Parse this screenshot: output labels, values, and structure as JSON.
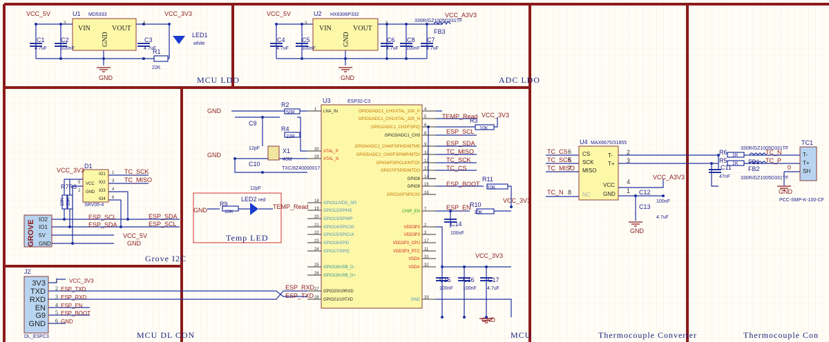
{
  "sections": {
    "mcu_ldo": "MCU LDO",
    "adc_ldo": "ADC LDO",
    "grove_i2c": "Grove I2C",
    "mcu_dl_con": "MCU DL CON",
    "mcu": "MCU",
    "tc_converter": "Thermocouple Converter",
    "tc_connector": "Thermocouple Con"
  },
  "mcu_ldo": {
    "vcc_in": "VCC_5V",
    "vcc_out": "VCC_3V3",
    "u1": "U1",
    "u1_part": "MD5333",
    "vin": "VIN",
    "vout": "VOUT",
    "gnd_pin": "GND",
    "pin3": "3",
    "pin2": "2",
    "c1": "C1",
    "c1_val": "4.7uF",
    "c2": "C2",
    "c2_val": "100nF",
    "c3": "C3",
    "c3_val": "4.7uF",
    "r1": "R1",
    "r1_val": "22K",
    "led1": "LED1",
    "led1_val": "white",
    "gnd": "GND"
  },
  "adc_ldo": {
    "vcc_in": "VCC_5V",
    "vcc_out": "VCC_A3V3",
    "u2": "U2",
    "u2_part": "HX6306P332",
    "vin": "VIN",
    "vout": "VOUT",
    "gnd_pin": "GND",
    "pin3": "3",
    "pin2": "2",
    "c4": "C4",
    "c4_val": "4.7uF",
    "c5": "C5",
    "c5_val": "100nF",
    "c6": "C6",
    "c6_val": "4.7uF",
    "c8": "C8",
    "c8_val": "100nF",
    "c7": "C7",
    "c7_val": "4.7uF",
    "fb3": "FB3",
    "fb3_val": "330R/GZ1005D331TF",
    "gnd": "GND"
  },
  "mcu": {
    "u3": "U3",
    "u3_part": "ESP32-C3",
    "left_pins": [
      {
        "name": "LNA_IN",
        "num": "1"
      },
      {
        "name": "XTAL_P",
        "num": "30"
      },
      {
        "name": "XTAL_N",
        "num": "29"
      },
      {
        "name": "GPIO11/VDD_SPI",
        "num": "18"
      },
      {
        "name": "GPIO12/SPIHD",
        "num": "19"
      },
      {
        "name": "GPIO13/SPIWP",
        "num": "20"
      },
      {
        "name": "GPIO14/SPICS0",
        "num": "21"
      },
      {
        "name": "GPIO15/SPICLK",
        "num": "22"
      },
      {
        "name": "GPIO16/SPID",
        "num": "23"
      },
      {
        "name": "GPIO17/SPIQ",
        "num": "24"
      },
      {
        "name": "GPIO18/USB_D-",
        "num": "25"
      },
      {
        "name": "GPIO19/USB_D+",
        "num": "26"
      },
      {
        "name": "GPIO20/U0RXD",
        "num": "27"
      },
      {
        "name": "GPIO21/U0TXD",
        "num": "28"
      }
    ],
    "right_pins": [
      {
        "name": "GPIO0/ADC1_CH0/XTAL_32K_P",
        "num": "4"
      },
      {
        "name": "GPIO1/ADC1_CH1/XTAL_32K_N",
        "num": "5"
      },
      {
        "name": "GPIO2/ADC1_CH2/FSPIQ",
        "num": "6"
      },
      {
        "name": "GPIO3/ADC1_CH3",
        "num": "8"
      },
      {
        "name": "GPIO4/ADC1_CH4/FSPIHD/MTMS",
        "num": "9"
      },
      {
        "name": "GPIO5/ADC2_CH0/FSPIWP/MTDI",
        "num": "10"
      },
      {
        "name": "GPIO6/FSPICLK/MTCK",
        "num": "12"
      },
      {
        "name": "GPIO7/FSPID/MTDO",
        "num": "13"
      },
      {
        "name": "GPIO8",
        "num": "14"
      },
      {
        "name": "GPIO9",
        "num": "15"
      },
      {
        "name": "GPIO10/FSPICS0",
        "num": "16"
      },
      {
        "name": "CHIP_EN",
        "num": "7"
      },
      {
        "name": "VDD3P3",
        "num": "2"
      },
      {
        "name": "VDD3P3",
        "num": "3"
      },
      {
        "name": "VDD3P3_CPU",
        "num": "17"
      },
      {
        "name": "VDD3P3_RTC",
        "num": "11"
      },
      {
        "name": "VDDA",
        "num": "31"
      },
      {
        "name": "VDDA",
        "num": "32"
      },
      {
        "name": "GND",
        "num": "33"
      }
    ],
    "nets": {
      "temp_read": "TEMP_Read",
      "esp_scl": "ESP_SCL",
      "esp_sda": "ESP_SDA",
      "tc_miso": "TC_MISO",
      "tc_sck": "TC_SCK",
      "tc_cs": "TC_CS",
      "esp_boot": "ESP_BOOT",
      "esp_en": "ESP_EN",
      "esp_rxd": "ESP_RXD",
      "esp_txd": "ESP_TXD",
      "vcc_3v3": "VCC_3V3",
      "gnd": "GND"
    },
    "r3": "R3",
    "r3_val": "10K",
    "r11": "R11",
    "r11_val": "10K",
    "r10": "R10",
    "r10_val": "10K",
    "c14": "C14",
    "c14_val": "100nF",
    "c15": "C15",
    "c15_val": "100nF",
    "c16": "C16",
    "c16_val": "100nF",
    "c17": "C17",
    "c17_val": "4.7uF",
    "r2": "R2",
    "r2_val": "50R",
    "r4": "R4",
    "r4_val": "22R",
    "c9": "C9",
    "c9_val": "12pF",
    "c10": "C10",
    "c10_val": "12pF",
    "x1": "X1",
    "x1_val": "40M",
    "x1_part": "TXC/8Z40000017",
    "temp_led_title": "Temp LED",
    "led2": "LED2",
    "led2_val": "red",
    "r9": "R9",
    "r9_val": "10K"
  },
  "grove": {
    "d1": "D1",
    "d1_part": "SRV05-4",
    "vcc_3v3": "VCC_3V3",
    "r7r8": "R7R8",
    "r_val": "10K",
    "d1_pins": [
      "VCC",
      "GND",
      "IO1",
      "IO2",
      "IO3",
      "IO4"
    ],
    "d1_nums": [
      "5",
      "2",
      "1",
      "3",
      "4",
      "6"
    ],
    "tc_sck": "TC_SCK",
    "tc_miso": "TC_MISO",
    "connector": "GROVE",
    "pins": [
      "IO2",
      "IO1",
      "5V",
      "GND"
    ],
    "esp_scl": "ESP_SCL",
    "esp_sda": "ESP_SDA",
    "vcc_5v": "VCC_5V",
    "gnd": "GND"
  },
  "dl_con": {
    "j2": "J2",
    "part": "DL_ESPC3",
    "pins": [
      "3V3",
      "TXD",
      "RXD",
      "EN",
      "G9",
      "GND"
    ],
    "nums": [
      "1",
      "2",
      "3",
      "4",
      "5",
      "6"
    ],
    "nets": [
      "VCC_3V3",
      "ESP_TXD",
      "ESP_RXD",
      "ESP_EN",
      "ESP_BOOT",
      "GND"
    ]
  },
  "tc_conv": {
    "u4": "U4",
    "u4_part": "MAX6675/31855",
    "pins_left": [
      "CS",
      "SCK",
      "MISO",
      "NC"
    ],
    "pins_right": [
      "T-",
      "T+",
      "VCC",
      "GND"
    ],
    "nets_left": [
      "TC_CS",
      "TC_SCK",
      "TC_MISO",
      "TC_N"
    ],
    "nums_left": [
      "6",
      "5",
      "7",
      "8"
    ],
    "nums_right": [
      "2",
      "3",
      "4",
      "1"
    ],
    "vcc": "VCC_A3V3",
    "c12": "C12",
    "c12_val": "100nF",
    "c13": "C13",
    "c13_val": "4.7uF",
    "gnd": "GND"
  },
  "tc_con": {
    "r6": "R6",
    "r5": "R5",
    "r_val": "1K",
    "c11": "C11",
    "c11_val": "47nF",
    "fb1": "FB1",
    "fb2": "FB2",
    "fb_val": "330R/GZ1005D331TF",
    "tc_n": "TC_N",
    "tc_p": "TC_P",
    "zero": "0",
    "tc1": "TC1",
    "tc1_pins": [
      "T-",
      "T+",
      "SH"
    ],
    "tc1_part": "PCC-SMP-K-100-CF",
    "gnd": "GND"
  },
  "colors": {
    "frame": "#8b1a1a",
    "wire": "#1f2f9f",
    "net_label": "#8b1a1a",
    "ic_fill": "#fdf8a8",
    "connector_fill": "#b8d4f0"
  }
}
